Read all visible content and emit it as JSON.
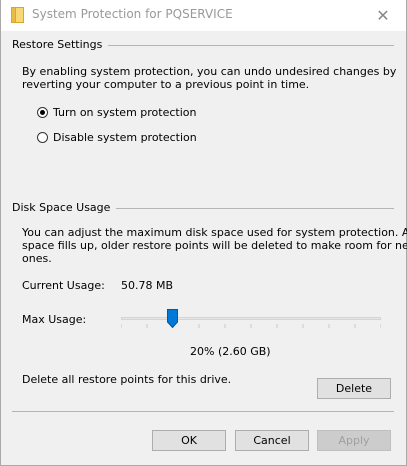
{
  "window": {
    "title": "System Protection for PQSERVICE",
    "close_glyph": "✕"
  },
  "restore_settings": {
    "heading": "Restore Settings",
    "description_line1": "By enabling system protection, you can undo undesired changes by",
    "description_line2": "reverting your computer to a previous point in time.",
    "options": [
      {
        "label": "Turn on system protection",
        "checked": true
      },
      {
        "label": "Disable system protection",
        "checked": false
      }
    ]
  },
  "disk_space": {
    "heading": "Disk Space Usage",
    "description_line1": "You can adjust the maximum disk space used for system protection. As",
    "description_line2": "space fills up, older restore points will be deleted to make room for new",
    "description_line3": "ones.",
    "current_usage_label": "Current Usage:",
    "current_usage_value": "50.78 MB",
    "max_usage_label": "Max Usage:",
    "max_usage_fraction": 0.2,
    "max_usage_readout": "20% (2.60 GB)",
    "delete_text": "Delete all restore points for this drive.",
    "delete_button": "Delete"
  },
  "footer": {
    "ok": "OK",
    "cancel": "Cancel",
    "apply": "Apply",
    "apply_enabled": false
  },
  "icons": {
    "title_icon": "folder-icon",
    "close_icon": "close-icon",
    "slider_thumb": "slider-thumb"
  },
  "colors": {
    "slider_thumb": "#0078d7",
    "title_text": "#999999"
  }
}
